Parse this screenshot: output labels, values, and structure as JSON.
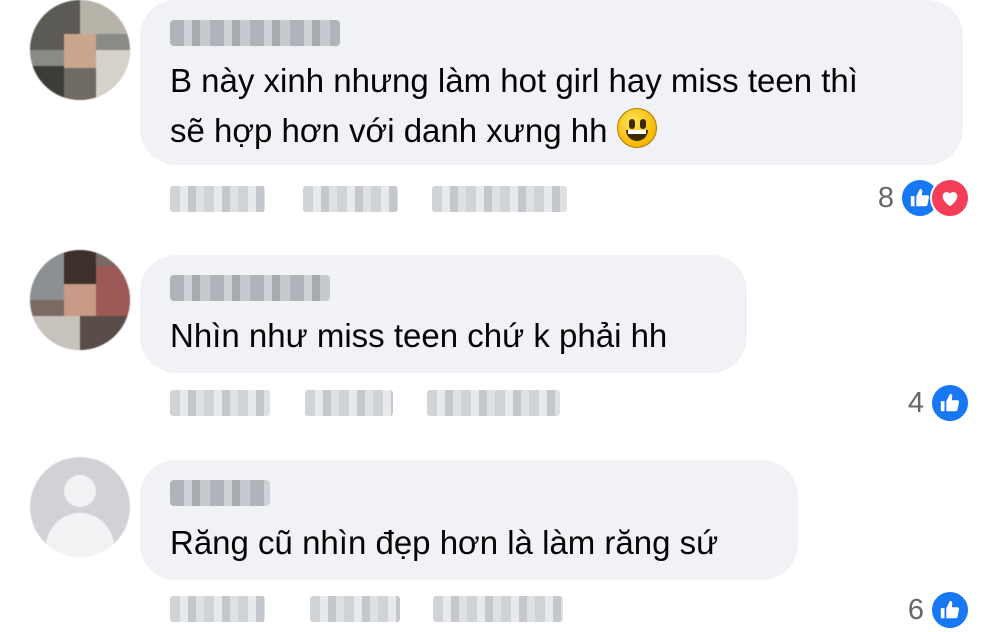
{
  "comments": [
    {
      "lines": [
        "B này xinh nhưng làm hot girl hay miss teen thì",
        "sẽ hợp hơn với danh xưng hh"
      ],
      "has_emoji": true,
      "emoji": "grinning-face",
      "reaction_count": "8",
      "reactions": [
        "like",
        "love"
      ]
    },
    {
      "lines": [
        "Nhìn như miss teen chứ k phải hh"
      ],
      "has_emoji": false,
      "reaction_count": "4",
      "reactions": [
        "like"
      ]
    },
    {
      "lines": [
        "Răng cũ nhìn đẹp hơn là làm răng sứ"
      ],
      "has_emoji": false,
      "reaction_count": "6",
      "reactions": [
        "like"
      ]
    }
  ],
  "colors": {
    "bubble": "#f0f2f5",
    "like": "#1877f2",
    "love": "#f33e58",
    "count": "#65676b"
  }
}
